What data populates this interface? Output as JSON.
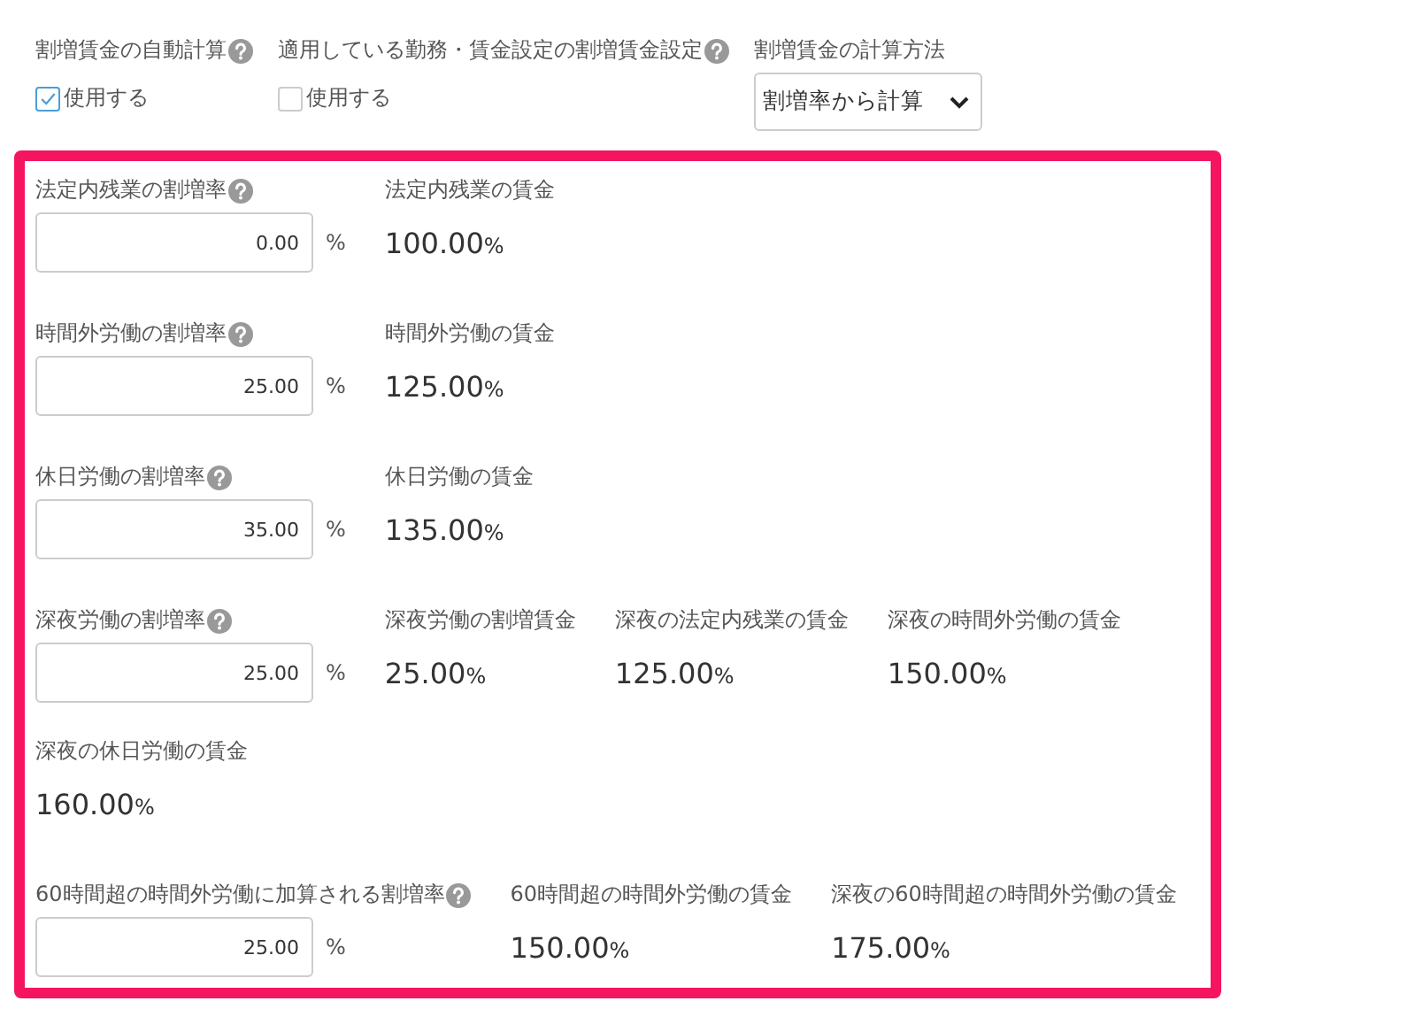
{
  "settings": [
    {
      "kind": "checkbox",
      "label": "割増賃金の自動計算",
      "help": true,
      "option": "使用する",
      "checked": true
    },
    {
      "kind": "checkbox",
      "label": "適用している勤務・賃金設定の割増賃金設定",
      "help": true,
      "option": "使用する",
      "checked": false
    },
    {
      "kind": "select",
      "label": "割増賃金の計算方法",
      "help": false,
      "value": "割増率から計算"
    }
  ],
  "sections": [
    {
      "rate": {
        "label": "法定内残業の割増率",
        "help": true,
        "value": "0.00",
        "unit": "%"
      },
      "wages": [
        {
          "label": "法定内残業の賃金",
          "value": "100.00",
          "unit": "%"
        }
      ]
    },
    {
      "rate": {
        "label": "時間外労働の割増率",
        "help": true,
        "value": "25.00",
        "unit": "%"
      },
      "wages": [
        {
          "label": "時間外労働の賃金",
          "value": "125.00",
          "unit": "%"
        }
      ]
    },
    {
      "rate": {
        "label": "休日労働の割増率",
        "help": true,
        "value": "35.00",
        "unit": "%"
      },
      "wages": [
        {
          "label": "休日労働の賃金",
          "value": "135.00",
          "unit": "%"
        }
      ]
    },
    {
      "rate": {
        "label": "深夜労働の割増率",
        "help": true,
        "value": "25.00",
        "unit": "%"
      },
      "wages": [
        {
          "label": "深夜労働の割増賃金",
          "value": "25.00",
          "unit": "%"
        },
        {
          "label": "深夜の法定内残業の賃金",
          "value": "125.00",
          "unit": "%"
        },
        {
          "label": "深夜の時間外労働の賃金",
          "value": "150.00",
          "unit": "%"
        },
        {
          "label": "深夜の休日労働の賃金",
          "value": "160.00",
          "unit": "%"
        }
      ]
    },
    {
      "rate": {
        "label": "60時間超の時間外労働に加算される割増率",
        "help": true,
        "value": "25.00",
        "unit": "%"
      },
      "wages": [
        {
          "label": "60時間超の時間外労働の賃金",
          "value": "150.00",
          "unit": "%"
        },
        {
          "label": "深夜の60時間超の時間外労働の賃金",
          "value": "175.00",
          "unit": "%"
        }
      ]
    }
  ]
}
